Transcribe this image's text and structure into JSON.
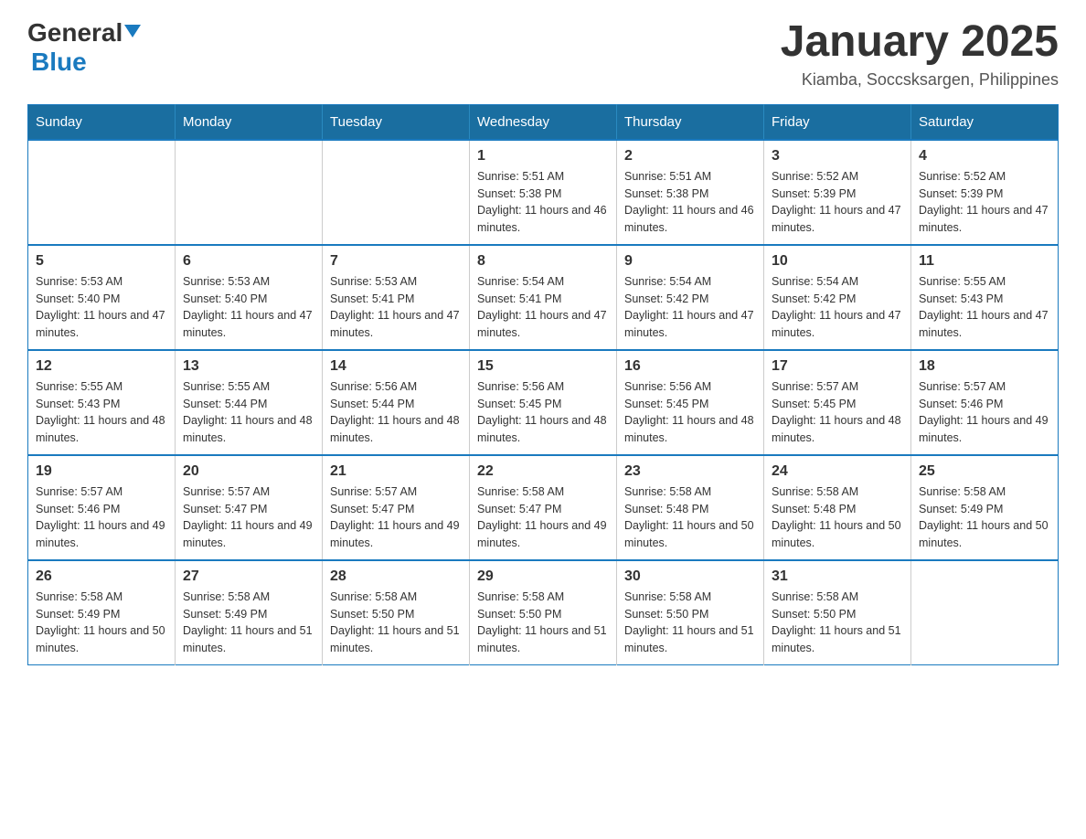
{
  "logo": {
    "general": "General",
    "blue": "Blue"
  },
  "header": {
    "month": "January 2025",
    "location": "Kiamba, Soccsksargen, Philippines"
  },
  "days": [
    "Sunday",
    "Monday",
    "Tuesday",
    "Wednesday",
    "Thursday",
    "Friday",
    "Saturday"
  ],
  "weeks": [
    [
      {
        "day": "",
        "info": ""
      },
      {
        "day": "",
        "info": ""
      },
      {
        "day": "",
        "info": ""
      },
      {
        "day": "1",
        "info": "Sunrise: 5:51 AM\nSunset: 5:38 PM\nDaylight: 11 hours and 46 minutes."
      },
      {
        "day": "2",
        "info": "Sunrise: 5:51 AM\nSunset: 5:38 PM\nDaylight: 11 hours and 46 minutes."
      },
      {
        "day": "3",
        "info": "Sunrise: 5:52 AM\nSunset: 5:39 PM\nDaylight: 11 hours and 47 minutes."
      },
      {
        "day": "4",
        "info": "Sunrise: 5:52 AM\nSunset: 5:39 PM\nDaylight: 11 hours and 47 minutes."
      }
    ],
    [
      {
        "day": "5",
        "info": "Sunrise: 5:53 AM\nSunset: 5:40 PM\nDaylight: 11 hours and 47 minutes."
      },
      {
        "day": "6",
        "info": "Sunrise: 5:53 AM\nSunset: 5:40 PM\nDaylight: 11 hours and 47 minutes."
      },
      {
        "day": "7",
        "info": "Sunrise: 5:53 AM\nSunset: 5:41 PM\nDaylight: 11 hours and 47 minutes."
      },
      {
        "day": "8",
        "info": "Sunrise: 5:54 AM\nSunset: 5:41 PM\nDaylight: 11 hours and 47 minutes."
      },
      {
        "day": "9",
        "info": "Sunrise: 5:54 AM\nSunset: 5:42 PM\nDaylight: 11 hours and 47 minutes."
      },
      {
        "day": "10",
        "info": "Sunrise: 5:54 AM\nSunset: 5:42 PM\nDaylight: 11 hours and 47 minutes."
      },
      {
        "day": "11",
        "info": "Sunrise: 5:55 AM\nSunset: 5:43 PM\nDaylight: 11 hours and 47 minutes."
      }
    ],
    [
      {
        "day": "12",
        "info": "Sunrise: 5:55 AM\nSunset: 5:43 PM\nDaylight: 11 hours and 48 minutes."
      },
      {
        "day": "13",
        "info": "Sunrise: 5:55 AM\nSunset: 5:44 PM\nDaylight: 11 hours and 48 minutes."
      },
      {
        "day": "14",
        "info": "Sunrise: 5:56 AM\nSunset: 5:44 PM\nDaylight: 11 hours and 48 minutes."
      },
      {
        "day": "15",
        "info": "Sunrise: 5:56 AM\nSunset: 5:45 PM\nDaylight: 11 hours and 48 minutes."
      },
      {
        "day": "16",
        "info": "Sunrise: 5:56 AM\nSunset: 5:45 PM\nDaylight: 11 hours and 48 minutes."
      },
      {
        "day": "17",
        "info": "Sunrise: 5:57 AM\nSunset: 5:45 PM\nDaylight: 11 hours and 48 minutes."
      },
      {
        "day": "18",
        "info": "Sunrise: 5:57 AM\nSunset: 5:46 PM\nDaylight: 11 hours and 49 minutes."
      }
    ],
    [
      {
        "day": "19",
        "info": "Sunrise: 5:57 AM\nSunset: 5:46 PM\nDaylight: 11 hours and 49 minutes."
      },
      {
        "day": "20",
        "info": "Sunrise: 5:57 AM\nSunset: 5:47 PM\nDaylight: 11 hours and 49 minutes."
      },
      {
        "day": "21",
        "info": "Sunrise: 5:57 AM\nSunset: 5:47 PM\nDaylight: 11 hours and 49 minutes."
      },
      {
        "day": "22",
        "info": "Sunrise: 5:58 AM\nSunset: 5:47 PM\nDaylight: 11 hours and 49 minutes."
      },
      {
        "day": "23",
        "info": "Sunrise: 5:58 AM\nSunset: 5:48 PM\nDaylight: 11 hours and 50 minutes."
      },
      {
        "day": "24",
        "info": "Sunrise: 5:58 AM\nSunset: 5:48 PM\nDaylight: 11 hours and 50 minutes."
      },
      {
        "day": "25",
        "info": "Sunrise: 5:58 AM\nSunset: 5:49 PM\nDaylight: 11 hours and 50 minutes."
      }
    ],
    [
      {
        "day": "26",
        "info": "Sunrise: 5:58 AM\nSunset: 5:49 PM\nDaylight: 11 hours and 50 minutes."
      },
      {
        "day": "27",
        "info": "Sunrise: 5:58 AM\nSunset: 5:49 PM\nDaylight: 11 hours and 51 minutes."
      },
      {
        "day": "28",
        "info": "Sunrise: 5:58 AM\nSunset: 5:50 PM\nDaylight: 11 hours and 51 minutes."
      },
      {
        "day": "29",
        "info": "Sunrise: 5:58 AM\nSunset: 5:50 PM\nDaylight: 11 hours and 51 minutes."
      },
      {
        "day": "30",
        "info": "Sunrise: 5:58 AM\nSunset: 5:50 PM\nDaylight: 11 hours and 51 minutes."
      },
      {
        "day": "31",
        "info": "Sunrise: 5:58 AM\nSunset: 5:50 PM\nDaylight: 11 hours and 51 minutes."
      },
      {
        "day": "",
        "info": ""
      }
    ]
  ]
}
